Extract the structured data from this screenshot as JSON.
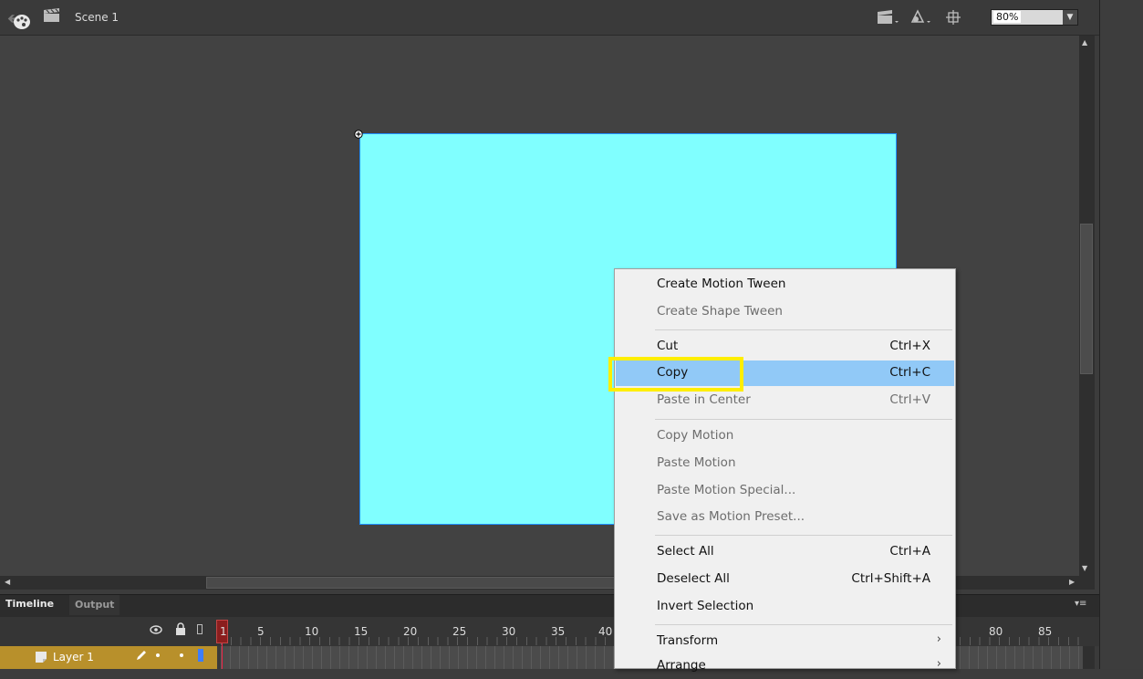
{
  "toolbar": {
    "scene_label": "Scene 1",
    "zoom_value": "80%"
  },
  "timeline": {
    "tab_timeline": "Timeline",
    "tab_output": "Output",
    "frame_numbers": [
      "1",
      "5",
      "10",
      "15",
      "20",
      "25",
      "30",
      "35",
      "40",
      "80",
      "85"
    ],
    "layer_name": "Layer 1"
  },
  "context_menu": {
    "items": [
      {
        "label": "Create Motion Tween",
        "shortcut": "",
        "enabled": true
      },
      {
        "label": "Create Shape Tween",
        "shortcut": "",
        "enabled": false
      },
      {
        "label": "Cut",
        "shortcut": "Ctrl+X",
        "enabled": true
      },
      {
        "label": "Copy",
        "shortcut": "Ctrl+C",
        "enabled": true,
        "highlighted": true
      },
      {
        "label": "Paste in Center",
        "shortcut": "Ctrl+V",
        "enabled": false
      },
      {
        "label": "Copy Motion",
        "shortcut": "",
        "enabled": false
      },
      {
        "label": "Paste Motion",
        "shortcut": "",
        "enabled": false
      },
      {
        "label": "Paste Motion Special...",
        "shortcut": "",
        "enabled": false
      },
      {
        "label": "Save as Motion Preset...",
        "shortcut": "",
        "enabled": false
      },
      {
        "label": "Select All",
        "shortcut": "Ctrl+A",
        "enabled": true
      },
      {
        "label": "Deselect All",
        "shortcut": "Ctrl+Shift+A",
        "enabled": true
      },
      {
        "label": "Invert Selection",
        "shortcut": "",
        "enabled": true
      },
      {
        "label": "Transform",
        "shortcut": "",
        "enabled": true,
        "submenu": true
      },
      {
        "label": "Arrange",
        "shortcut": "",
        "enabled": true,
        "submenu": true
      }
    ]
  },
  "colors": {
    "canvas_fill": "#80ffff",
    "menu_highlight": "#91c9f7",
    "annotation_box": "#ffee00",
    "layer_row": "#b8902b",
    "playhead": "#8b1e1e"
  }
}
